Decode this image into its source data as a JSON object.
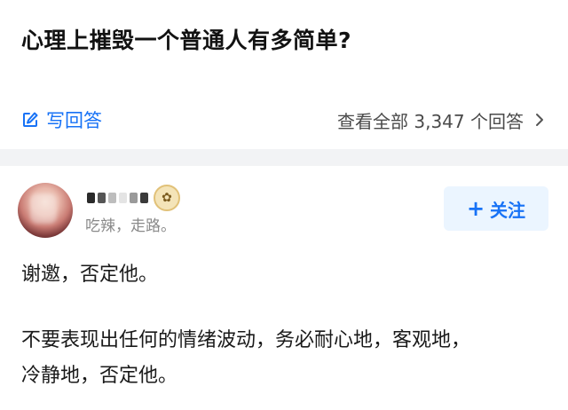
{
  "question": {
    "title": "心理上摧毁一个普通人有多简单?"
  },
  "actions": {
    "write_answer_label": "写回答",
    "view_all_label": "查看全部 3,347 个回答"
  },
  "author": {
    "bio": "吃辣，走路。"
  },
  "follow_button": {
    "plus": "+",
    "label": "关注"
  },
  "answer": {
    "paragraph_1": "谢邀，否定他。",
    "paragraph_2_line_1": "不要表现出任何的情绪波动，务必耐心地，客观地，",
    "paragraph_2_line_2": "冷静地，否定他。"
  },
  "colors": {
    "accent": "#1772f6",
    "follow_bg": "#ebf5ff",
    "divider": "#f2f3f5",
    "muted_text": "#8a8a8a"
  },
  "icons": {
    "write": "edit-icon",
    "chevron": "chevron-right-icon",
    "badge": "badge-icon"
  }
}
